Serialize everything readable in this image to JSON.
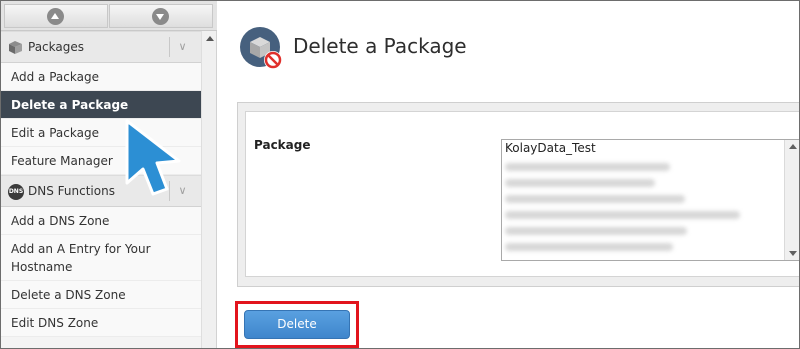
{
  "sidebar": {
    "nav_up_icon": "triangle-up-icon",
    "nav_down_icon": "triangle-down-icon",
    "categories": [
      {
        "label": "Packages",
        "icon": "package-icon",
        "items": [
          "Add a Package",
          "Delete a Package",
          "Edit a Package",
          "Feature Manager"
        ],
        "active_index": 1
      },
      {
        "label": "DNS Functions",
        "icon": "dns-icon",
        "icon_text": "DNS",
        "items": [
          "Add a DNS Zone",
          "Add an A Entry for Your Hostname",
          "Delete a DNS Zone",
          "Edit DNS Zone"
        ]
      }
    ]
  },
  "main": {
    "title": "Delete a Package",
    "form": {
      "package_label": "Package",
      "package_options_visible": [
        "KolayData_Test"
      ],
      "selected": "KolayData_Test"
    },
    "delete_button": "Delete"
  },
  "colors": {
    "active_item_bg": "#3d4752",
    "button_blue": "#4a90d6",
    "highlight_red": "#e2141d",
    "cursor_blue": "#2c8fd4"
  }
}
